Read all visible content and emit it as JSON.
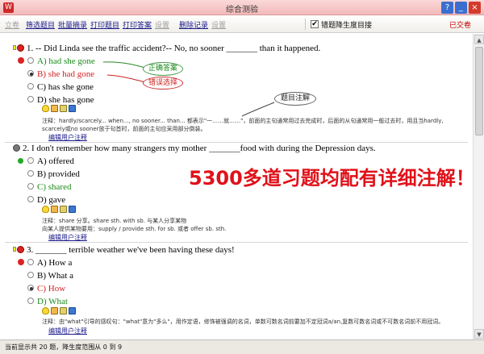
{
  "window": {
    "title": "综合测验",
    "app_icon": "W",
    "help_label": "?",
    "min_label": "_",
    "close_label": "×"
  },
  "toolbar": {
    "items": [
      "立卷",
      "筛选题目",
      "批量摘录",
      "打印题目",
      "打印答案",
      "设置",
      "删除记录",
      "设置"
    ],
    "filter_checkbox_label": "错题降生度目接",
    "filter_checked": true,
    "check_glyph": "✔",
    "right_label": "已交卷"
  },
  "questions": [
    {
      "number": "1.",
      "text": "-- Did Linda see the traffic accident?-- No, no sooner _______ than it happened.",
      "status": "wrong",
      "options": [
        {
          "label": "A) had she gone",
          "state": "correct_answer"
        },
        {
          "label": "B) she had gone",
          "state": "selected_wrong"
        },
        {
          "label": "C) has she gone",
          "state": "none"
        },
        {
          "label": "D) she has gone",
          "state": "none"
        }
      ],
      "note": "注释：hardly/scarcely... when..., no sooner... than... 都表示\"一……就……\"，前面的主句通常用过去完成时，后面的从句通常用一般过去时，用且当hardly, scarcely或no sooner放于句首时，前面的主句应采用部分倒装。",
      "edit_link": "编辑用户注释"
    },
    {
      "number": "2.",
      "text": "I don't remember how many strangers my mother _______food with during the Depression days.",
      "status": "unanswered",
      "options": [
        {
          "label": "A) offered",
          "state": "none"
        },
        {
          "label": "B) provided",
          "state": "none"
        },
        {
          "label": "C) shared",
          "state": "correct_answer"
        },
        {
          "label": "D) gave",
          "state": "none"
        }
      ],
      "note": "注释：share 分享。share sth. with sb. 与某人分享某物\n向某人提供某物要用：supply / provide sth. for sb. 或者 offer sb. sth.",
      "edit_link": "编辑用户注释"
    },
    {
      "number": "3.",
      "text": "_______ terrible weather we've been having these days!",
      "status": "wrong",
      "options": [
        {
          "label": "A) How a",
          "state": "none"
        },
        {
          "label": "B) What a",
          "state": "none"
        },
        {
          "label": "C) How",
          "state": "selected_wrong"
        },
        {
          "label": "D) What",
          "state": "correct_answer"
        }
      ],
      "note": "注释：由\"what\"引导的感叹句：\"what\"意为\"多么\"，用作定语，修饰被强调的名词，单数可数名词前要加不定冠词a/an,复数可数名词或不可数名词前不用冠词。",
      "edit_link": "编辑用户注释"
    }
  ],
  "annotations": {
    "correct_answer": "正确答案",
    "wrong_choice": "错误选择",
    "question_note": "题目注解",
    "promo": "5300多道习题均配有详细注解！"
  },
  "statusbar": {
    "text": "当前显示共 20 题，降生度范围从 0 到 9"
  },
  "colors": {
    "correct": "#1a8a1a",
    "wrong": "#d42020",
    "promo": "#e0111a"
  }
}
